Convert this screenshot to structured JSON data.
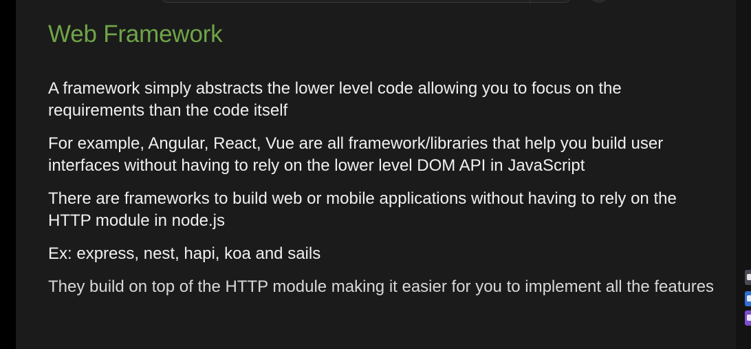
{
  "slide": {
    "title": "Web Framework",
    "paragraphs": [
      "A framework simply abstracts the lower level code allowing you to focus on the requirements than the code itself",
      "For example, Angular, React, Vue are all framework/libraries that help you build user interfaces without having to rely on the lower level DOM API in JavaScript",
      "There are frameworks to build web or mobile applications without having to rely on the HTTP module in node.js",
      "Ex: express, nest, hapi, koa and sails",
      "They build on top of the HTTP module making it easier for you to implement all the features"
    ]
  },
  "colors": {
    "title": "#6fa548",
    "text": "#f0f0f0",
    "background": "#1b1b1b"
  },
  "side_widgets": [
    "toolbar-icon",
    "blue-app-icon",
    "purple-app-icon"
  ]
}
